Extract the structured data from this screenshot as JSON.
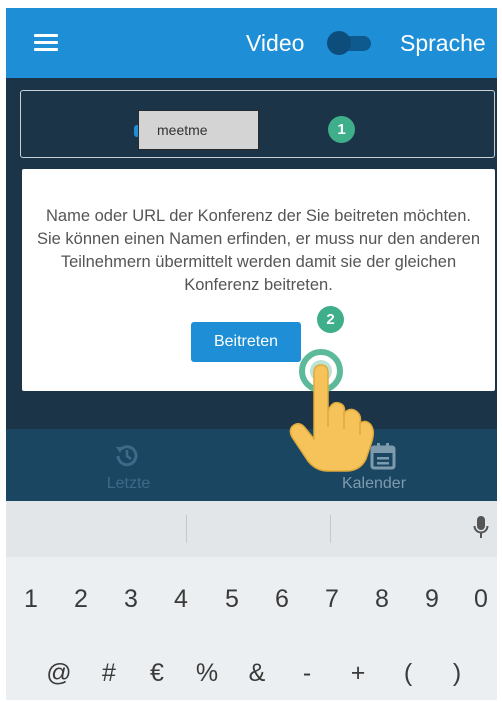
{
  "appbar": {
    "video_label": "Video",
    "language_label": "Sprache"
  },
  "room": {
    "value": "meetme",
    "step": "1"
  },
  "info": {
    "text": "Name oder URL der Konferenz der Sie beitreten möchten. Sie können einen Namen erfinden, er muss nur den anderen Teilnehmern übermittelt werden damit sie der gleichen Konferenz beitreten.",
    "join_label": "Beitreten",
    "step": "2"
  },
  "tabs": [
    {
      "label": "Letzte",
      "icon": "history-icon"
    },
    {
      "label": "Kalender",
      "icon": "calendar-icon"
    }
  ],
  "keyboard": {
    "digits": [
      "1",
      "2",
      "3",
      "4",
      "5",
      "6",
      "7",
      "8",
      "9",
      "0"
    ],
    "symbols": [
      "@",
      "#",
      "€",
      "%",
      "&",
      "-",
      "+",
      "(",
      ")"
    ],
    "mic_icon": "microphone-icon"
  },
  "colors": {
    "primary": "#1e8fd6",
    "dark_bg": "#1c3447",
    "step_badge": "#3fae8a"
  }
}
